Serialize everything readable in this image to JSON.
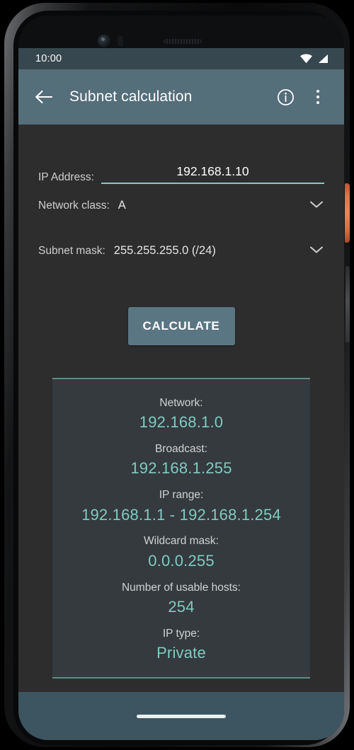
{
  "status_bar": {
    "time": "10:00",
    "icons": [
      "wifi-icon",
      "cellular-signal-icon"
    ]
  },
  "app_bar": {
    "back_icon": "back-arrow-icon",
    "title": "Subnet calculation",
    "info_icon": "info-circle-icon",
    "overflow_icon": "overflow-menu-icon"
  },
  "form": {
    "ip_address": {
      "label": "IP Address:",
      "value": "192.168.1.10",
      "placeholder": "192.168.1.10"
    },
    "network_class": {
      "label": "Network class:",
      "value": "A",
      "caret_icon": "chevron-down-icon"
    },
    "subnet_mask": {
      "label": "Subnet mask:",
      "value": "255.255.255.0  (/24)",
      "caret_icon": "chevron-down-icon"
    }
  },
  "actions": {
    "calculate_label": "CALCULATE"
  },
  "results": [
    {
      "label": "Network:",
      "value": "192.168.1.0"
    },
    {
      "label": "Broadcast:",
      "value": "192.168.1.255"
    },
    {
      "label": "IP range:",
      "value": "192.168.1.1 - 192.168.1.254"
    },
    {
      "label": "Wildcard mask:",
      "value": "0.0.0.255"
    },
    {
      "label": "Number of usable hosts:",
      "value": "254"
    },
    {
      "label": "IP type:",
      "value": "Private"
    }
  ],
  "nav_bar": {
    "gesture_pill": "home-gesture-pill"
  },
  "colors": {
    "app_bar": "#546e7a",
    "status_bar": "#37474f",
    "background": "#2d2d2d",
    "card": "#343a3d",
    "accent_teal": "#80cbc4",
    "button": "#5b7683",
    "nav_bar": "#3d5560",
    "power_button": "#f0825a"
  }
}
